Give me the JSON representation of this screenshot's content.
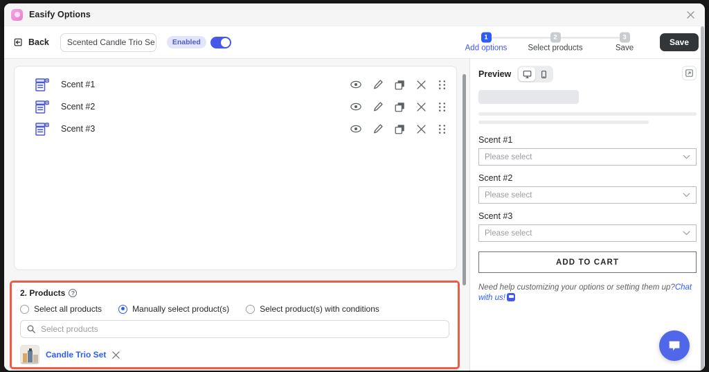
{
  "window": {
    "app_title": "Easify Options",
    "app_icon": "easify-app-icon",
    "close_icon": "close-icon"
  },
  "toolbar": {
    "back_label": "Back",
    "back_icon": "back-arrow-icon",
    "title_value": "Scented Candle Trio Se",
    "title_placeholder": "Option set name",
    "enabled_badge": "Enabled",
    "toggle_state": "on",
    "save_label": "Save",
    "steps": [
      {
        "num": "1",
        "label": "Add options",
        "active": true
      },
      {
        "num": "2",
        "label": "Select products",
        "active": false
      },
      {
        "num": "3",
        "label": "Save",
        "active": false
      }
    ]
  },
  "options_list": {
    "rows": [
      {
        "label": "Scent #1",
        "icon": "dropdown-field-icon"
      },
      {
        "label": "Scent #2",
        "icon": "dropdown-field-icon"
      },
      {
        "label": "Scent #3",
        "icon": "dropdown-field-icon"
      }
    ],
    "actions": [
      "eye-icon",
      "pencil-icon",
      "duplicate-icon",
      "delete-x-icon",
      "drag-handle-icon"
    ]
  },
  "products": {
    "heading": "2. Products",
    "help_icon": "help-question-icon",
    "radios": [
      {
        "label": "Select all products",
        "selected": false
      },
      {
        "label": "Manually select product(s)",
        "selected": true
      },
      {
        "label": "Select product(s) with conditions",
        "selected": false
      }
    ],
    "search_placeholder": "Select products",
    "search_icon": "search-icon",
    "selected_products": [
      {
        "name": "Candle Trio Set",
        "remove_icon": "remove-x-icon"
      }
    ]
  },
  "preview": {
    "title": "Preview",
    "device_desktop_icon": "desktop-icon",
    "device_mobile_icon": "mobile-icon",
    "device_active": "desktop",
    "expand_icon": "expand-icon",
    "fields": [
      {
        "label": "Scent #1",
        "placeholder": "Please select"
      },
      {
        "label": "Scent #2",
        "placeholder": "Please select"
      },
      {
        "label": "Scent #3",
        "placeholder": "Please select"
      }
    ],
    "add_to_cart_label": "ADD TO CART",
    "help_text": "Need help customizing your options or setting them up?",
    "help_link": "Chat with us!",
    "chat_icon": "chat-bubble-icon"
  },
  "chat_widget": {
    "icon": "chat-bubble-icon"
  },
  "colors": {
    "accent_blue": "#2f5cf6",
    "toggle_blue": "#4458e9",
    "highlight_red": "#ef5b42",
    "dark_button": "#333638",
    "app_icon_pink": "#ea7fd2"
  }
}
